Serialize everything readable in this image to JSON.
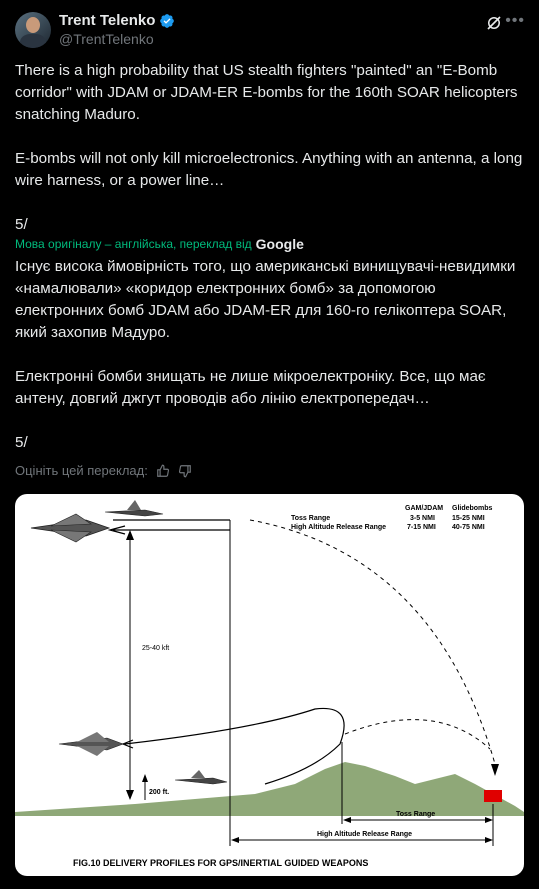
{
  "author": {
    "display_name": "Trent Telenko",
    "handle": "@TrentTelenko"
  },
  "tweet": {
    "paragraphs": [
      "There is a high probability that US stealth fighters \"painted\" an \"E-Bomb corridor\" with JDAM or JDAM-ER E-bombs for the 160th SOAR helicopters snatching Maduro.",
      "E-bombs will not only kill microelectronics.  Anything with an antenna, a long wire harness, or a power line…",
      "5/"
    ]
  },
  "translation": {
    "note": "Мова оригіналу – англійська, переклад від",
    "provider": "Google",
    "paragraphs": [
      "Існує висока ймовірність того, що американські винищувачі-невидимки «намалювали» «коридор електронних бомб» за допомогою електронних бомб JDAM або JDAM-ER для 160-го гелікоптера SOAR, який захопив Мадуро.",
      "Електронні бомби знищать не лише мікроелектроніку. Все, що має антену, довгий джгут проводів або лінію електропередач…",
      "5/"
    ],
    "rate_label": "Оцініть цей переклад:"
  },
  "figure": {
    "caption": "FIG.10 DELIVERY PROFILES FOR GPS/INERTIAL GUIDED WEAPONS",
    "table": {
      "col1": "GAM/JDAM",
      "col2": "Glidebombs",
      "row1_label": "Toss Range",
      "row1_v1": "3-5 NMI",
      "row1_v2": "15-25 NMI",
      "row2_label": "High Altitude Release Range",
      "row2_v1": "7-15 NMI",
      "row2_v2": "40-75 NMI"
    },
    "altitude_label": "25-40 kft",
    "low_alt_label": "200 ft.",
    "toss_range_label": "Toss Range",
    "high_alt_range_label": "High Altitude Release Range",
    "colors": {
      "target": "#e00000",
      "ground": "#8fa878"
    }
  }
}
